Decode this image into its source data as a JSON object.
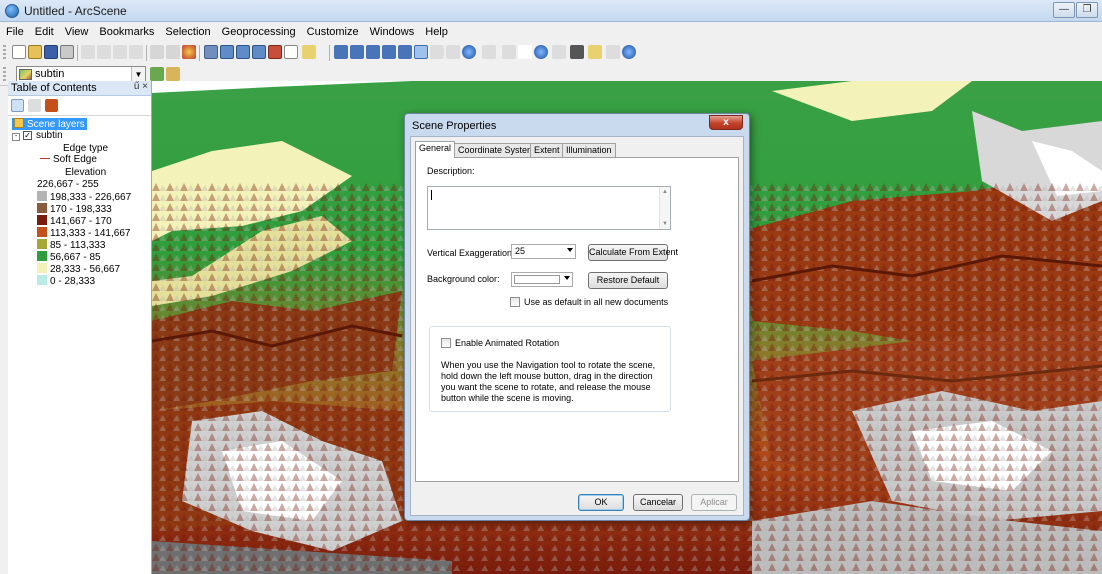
{
  "window": {
    "title": "Untitled - ArcScene",
    "minimize_label": "—",
    "restore_label": "❐"
  },
  "menu": [
    "File",
    "Edit",
    "View",
    "Bookmarks",
    "Selection",
    "Geoprocessing",
    "Customize",
    "Windows",
    "Help"
  ],
  "layer_combo": {
    "value": "subtin"
  },
  "toc": {
    "title": "Table of Contents",
    "pin_label": "ű",
    "close_label": "×",
    "scene_layers_label": "Scene layers",
    "layer_name": "subtin",
    "edge_type_label": "Edge type",
    "soft_edge_label": "Soft Edge",
    "elevation_label": "Elevation",
    "classes": [
      {
        "label": "226,667 - 255",
        "color": "#ffffff"
      },
      {
        "label": "198,333 - 226,667",
        "color": "#b3b3b3"
      },
      {
        "label": "170 - 198,333",
        "color": "#8a5a3c"
      },
      {
        "label": "141,667 - 170",
        "color": "#7a1c0c"
      },
      {
        "label": "113,333 - 141,667",
        "color": "#c4501a"
      },
      {
        "label": "85 - 113,333",
        "color": "#a5a832"
      },
      {
        "label": "56,667 - 85",
        "color": "#2e9e3a"
      },
      {
        "label": "28,333 - 56,667",
        "color": "#f3f2b8"
      },
      {
        "label": "0 - 28,333",
        "color": "#b9ece6"
      }
    ]
  },
  "dialog": {
    "title": "Scene Properties",
    "close_label": "x",
    "tabs": [
      "General",
      "Coordinate System",
      "Extent",
      "Illumination"
    ],
    "description_label": "Description:",
    "vertical_exaggeration_label": "Vertical Exaggeration:",
    "vertical_exaggeration_value": "25",
    "calculate_button": "Calculate From Extent",
    "background_color_label": "Background color:",
    "restore_default_button": "Restore Default",
    "use_default_label": "Use as default in all new documents",
    "animated_rotation_label": "Enable Animated Rotation",
    "rotation_help": "When you use the Navigation tool to rotate the scene, hold down the left mouse button, drag in the direction you want the scene to rotate, and release the mouse button while the scene is moving.",
    "ok_button": "OK",
    "cancel_button": "Cancelar",
    "apply_button": "Aplicar"
  },
  "colors": {
    "white": "#ffffff",
    "gray": "#b3b3b3",
    "brown": "#8a5a3c",
    "darkred": "#7a1c0c",
    "orange": "#c4501a",
    "olive": "#a5a832",
    "green": "#2e9e3a",
    "cream": "#f3f2b8",
    "cyan": "#b9ece6"
  }
}
